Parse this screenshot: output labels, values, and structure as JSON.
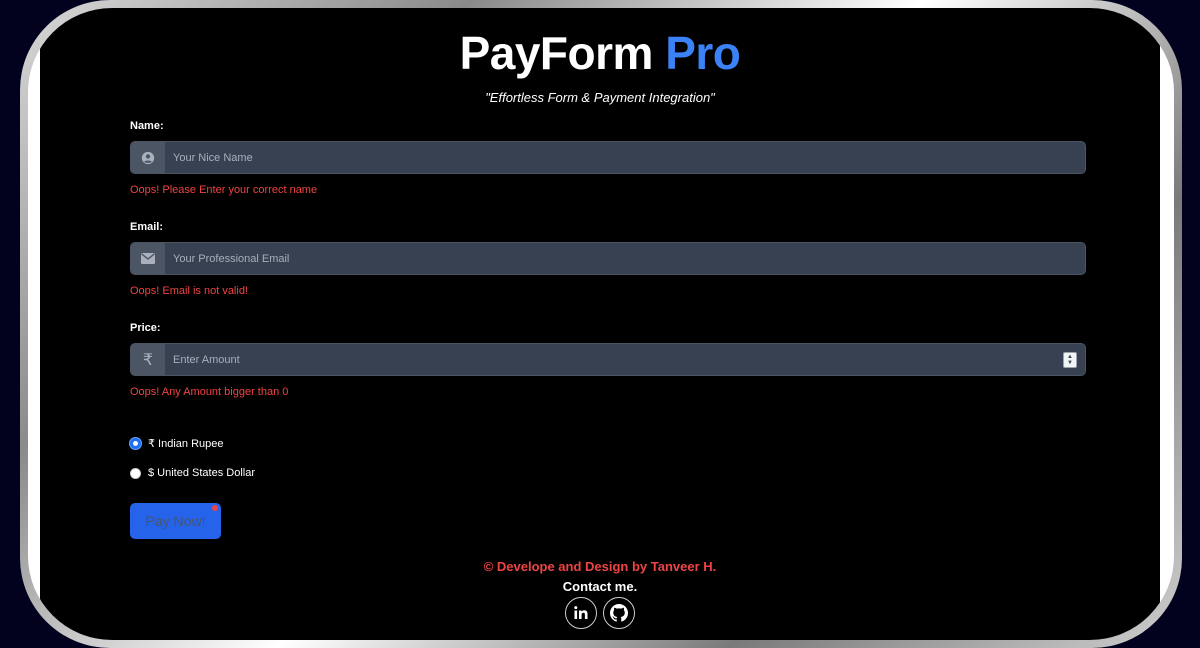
{
  "header": {
    "title_main": "PayForm",
    "title_accent": "Pro",
    "tagline": "\"Effortless Form & Payment Integration\""
  },
  "form": {
    "name": {
      "label": "Name:",
      "placeholder": "Your Nice Name",
      "error": "Oops! Please Enter your correct name",
      "icon": "user-circle-icon"
    },
    "email": {
      "label": "Email:",
      "placeholder": "Your Professional Email",
      "error": "Oops! Email is not valid!",
      "icon": "envelope-icon"
    },
    "price": {
      "label": "Price:",
      "placeholder": "Enter Amount",
      "error": "Oops! Any Amount bigger than 0",
      "icon": "rupee-icon",
      "addon_symbol": "₹"
    },
    "currency_options": [
      {
        "label": "₹ Indian Rupee",
        "checked": true
      },
      {
        "label": "$ United States Dollar",
        "checked": false
      }
    ],
    "submit_label": "Pay Now!"
  },
  "footer": {
    "credit": "© Develope and Design by Tanveer H.",
    "contact": "Contact me.",
    "social_icons": [
      "linkedin-icon",
      "github-icon"
    ]
  },
  "colors": {
    "accent": "#3b82f6",
    "error": "#ef4444",
    "button": "#2563eb",
    "input_bg": "#374151",
    "addon_bg": "#4b5563"
  }
}
